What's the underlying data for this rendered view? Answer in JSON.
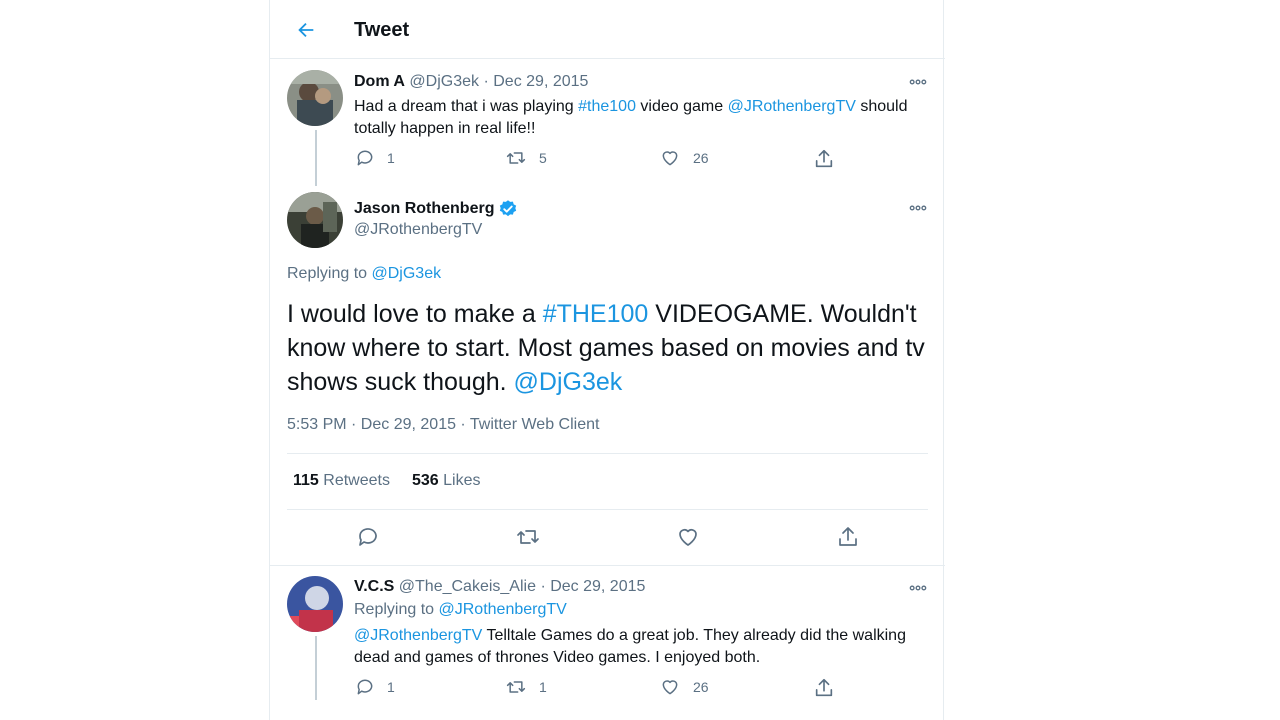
{
  "header": {
    "title": "Tweet"
  },
  "tweet1": {
    "name": "Dom A",
    "handle": "@DjG3ek",
    "dot": "·",
    "date": "Dec 29, 2015",
    "text_parts": [
      "Had a dream that i was playing ",
      "#the100",
      " video game ",
      "@JRothenbergTV",
      " should totally happen in real life!!"
    ],
    "replies": "1",
    "retweets": "5",
    "likes": "26"
  },
  "main": {
    "name": "Jason Rothenberg",
    "handle": "@JRothenbergTV",
    "replying_label": "Replying to ",
    "replying_to": "@DjG3ek",
    "text_parts": [
      "I would love to make a ",
      "#THE100",
      " VIDEOGAME. Wouldn't know where to start. Most games based on movies and tv shows suck though. ",
      "@DjG3ek"
    ],
    "meta": "5:53 PM · Dec 29, 2015 · Twitter Web Client",
    "retweet_count": "115",
    "retweet_label": "Retweets",
    "like_count": "536",
    "like_label": "Likes"
  },
  "reply": {
    "name": "V.C.S",
    "handle": "@The_Cakeis_Alie",
    "dot": "·",
    "date": "Dec 29, 2015",
    "replying_label": "Replying to ",
    "replying_to": "@JRothenbergTV",
    "text_parts": [
      "@JRothenbergTV",
      " Telltale Games do a great job. They already did the walking dead and games of thrones Video games. I enjoyed both."
    ],
    "replies": "1",
    "retweets": "1",
    "likes": "26"
  },
  "colors": {
    "accent": "#1b95e0",
    "muted": "#5b7083",
    "verified": "#1da1f2",
    "border": "#e6ecf0"
  },
  "icons": [
    "back-arrow-icon",
    "more-icon",
    "reply-icon",
    "retweet-icon",
    "like-icon",
    "share-icon",
    "verified-badge-icon"
  ]
}
